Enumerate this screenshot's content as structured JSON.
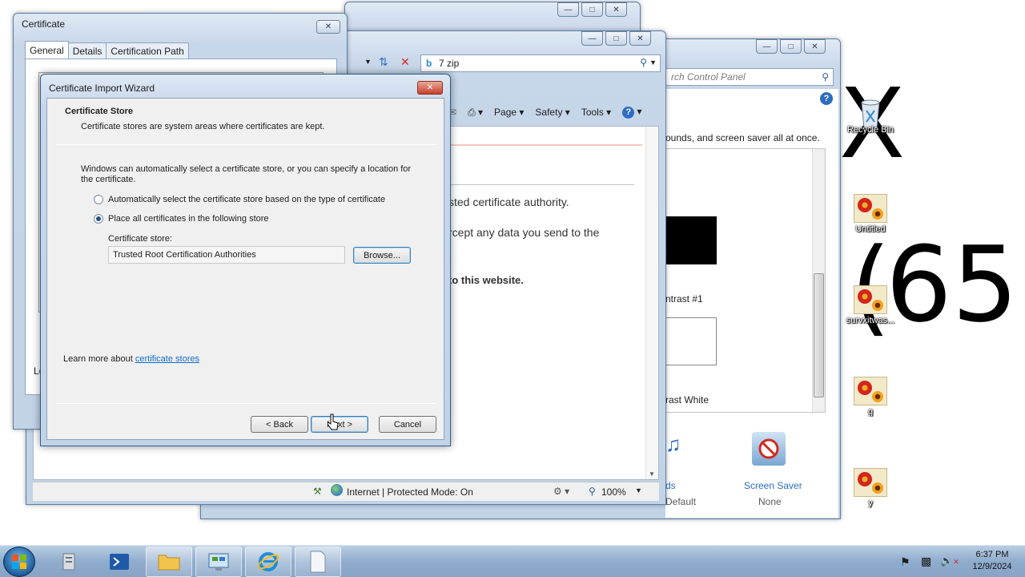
{
  "desktop": {
    "big_glyphs": {
      "x": "X",
      "paren": "(",
      "number": "65",
      "paren_close": "("
    },
    "icons": [
      {
        "label": "Recycle Bin",
        "icon": "recycle-bin-icon"
      },
      {
        "label": "Untitled",
        "icon": "image-file-icon"
      },
      {
        "label": "survxitwas...",
        "icon": "image-file-icon"
      },
      {
        "label": "g",
        "icon": "image-file-icon"
      },
      {
        "label": "y",
        "icon": "image-file-icon"
      }
    ]
  },
  "control_panel": {
    "search_placeholder": "rch Control Panel",
    "description": "ounds, and screen saver all at once.",
    "themes": [
      {
        "label": "ntrast #1"
      },
      {
        "label": "rast White"
      }
    ],
    "bottom_items": [
      {
        "label": "ds",
        "value": "Default"
      },
      {
        "label": "Screen Saver",
        "value": "None"
      }
    ]
  },
  "ie": {
    "address": "7 zip",
    "toolbar": {
      "page": "Page",
      "safety": "Safety",
      "tools": "Tools"
    },
    "content_lines": [
      ".",
      "sted certificate authority.",
      "rcept any data you send to the",
      "to this website."
    ],
    "status": {
      "zone": "Internet | Protected Mode: On",
      "zoom": "100%"
    }
  },
  "certificate": {
    "title": "Certificate",
    "tabs": [
      "General",
      "Details",
      "Certification Path"
    ],
    "fragment": "Le"
  },
  "wizard": {
    "title": "Certificate Import Wizard",
    "header_title": "Certificate Store",
    "header_desc": "Certificate stores are system areas where certificates are kept.",
    "intro": "Windows can automatically select a certificate store, or you can specify a location for the certificate.",
    "option_auto": "Automatically select the certificate store based on the type of certificate",
    "option_manual": "Place all certificates in the following store",
    "store_label": "Certificate store:",
    "store_value": "Trusted Root Certification Authorities",
    "browse": "Browse...",
    "learn_more_prefix": "Learn more about ",
    "learn_more_link": "certificate stores",
    "back": "< Back",
    "next": "Next >",
    "cancel": "Cancel"
  },
  "taskbar": {
    "time": "6:37 PM",
    "date": "12/9/2024"
  },
  "colors": {
    "accent": "#0d6ec8",
    "close_red": "#c7402c",
    "window_frame": "#c2d3e6"
  }
}
